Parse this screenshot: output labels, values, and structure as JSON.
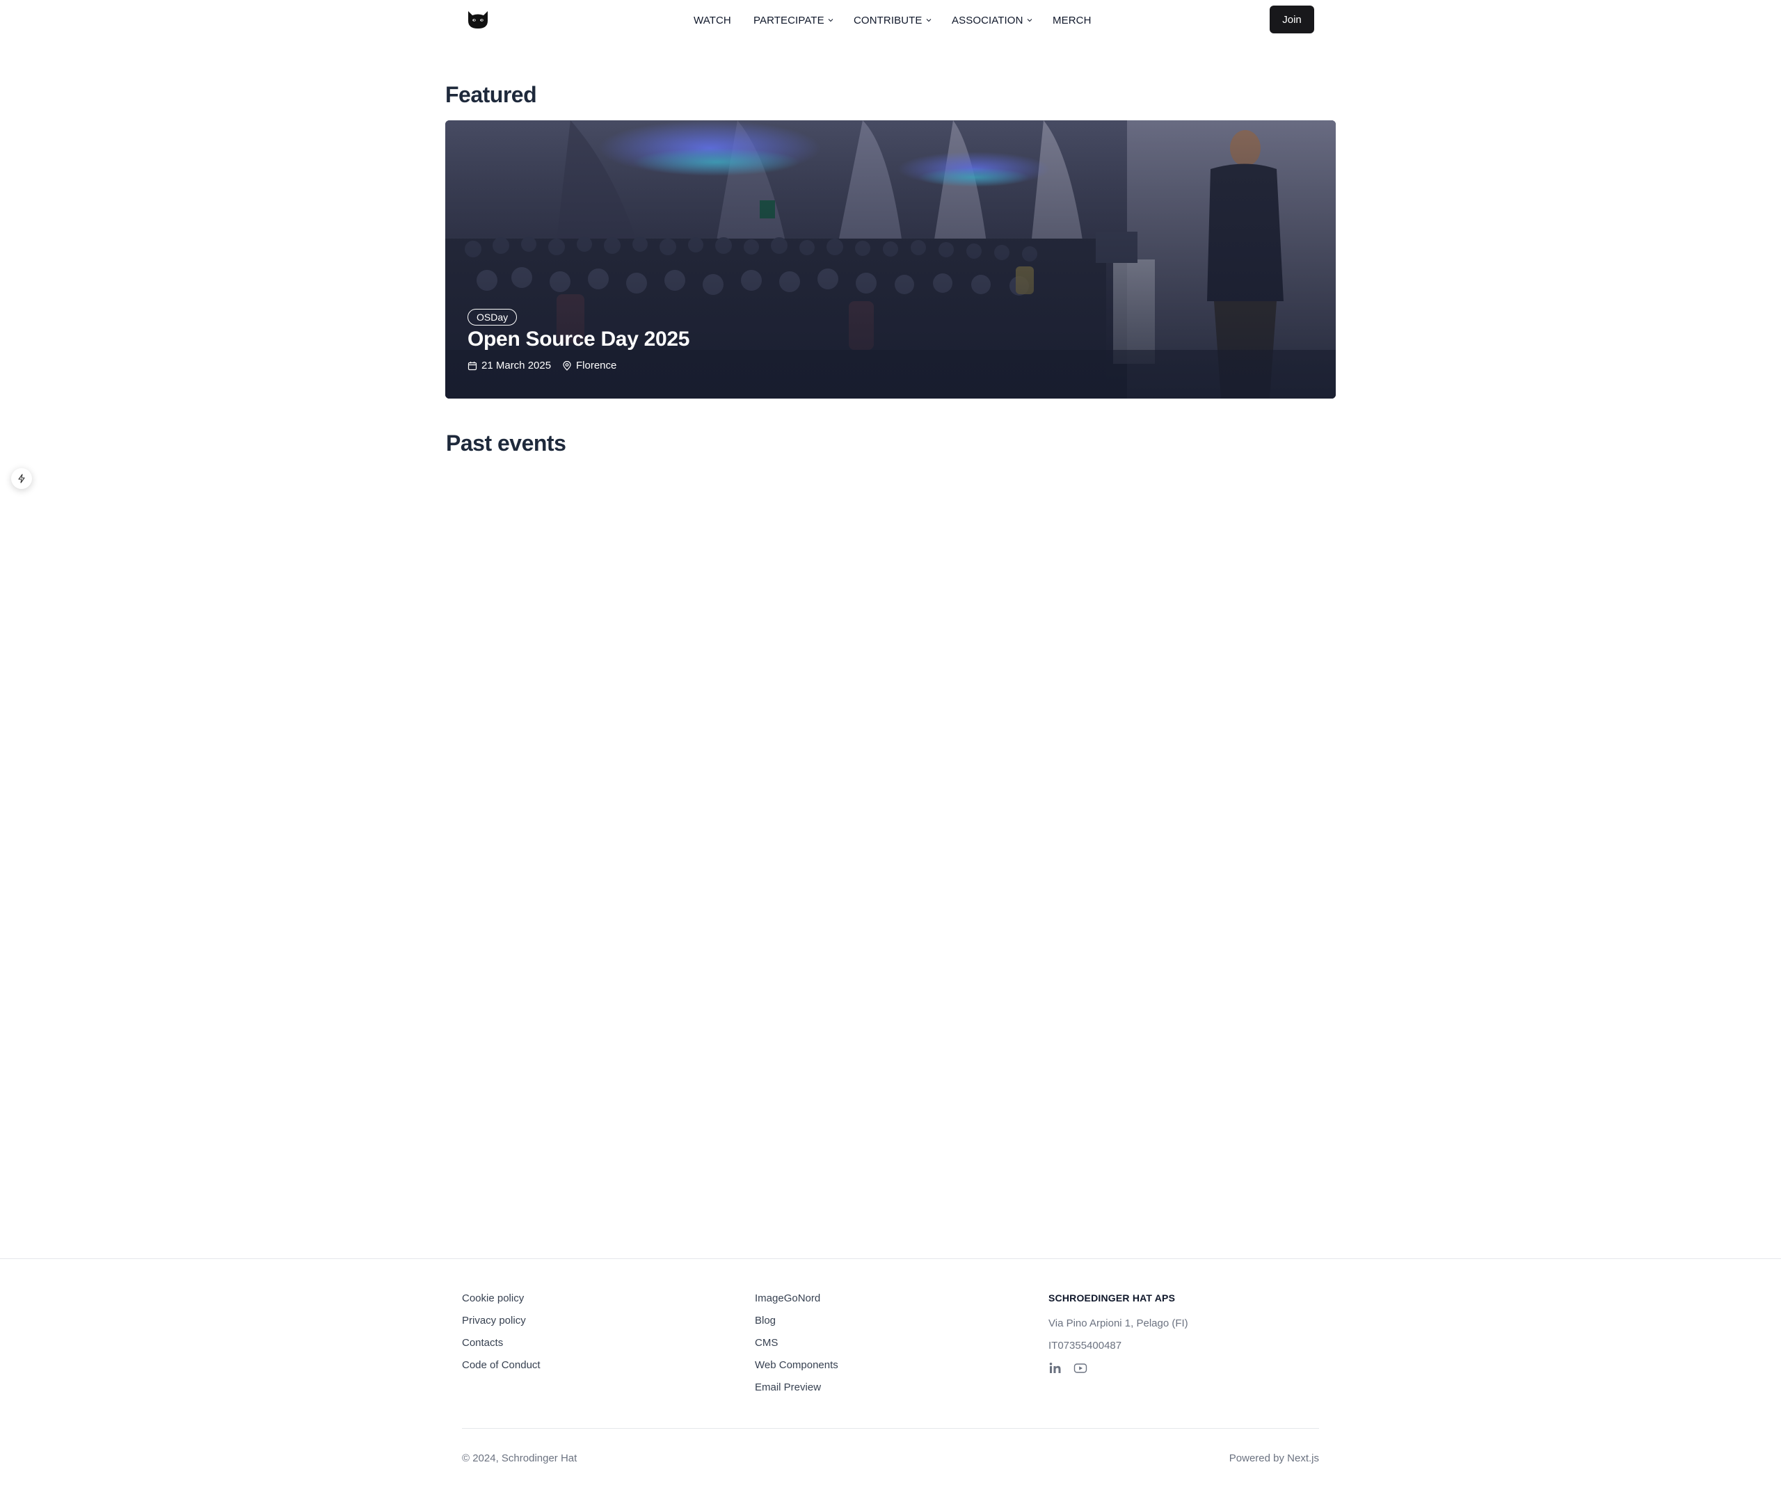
{
  "header": {
    "logo_icon": "cat-face-icon",
    "nav": [
      {
        "label": "WATCH",
        "has_dropdown": false
      },
      {
        "label": "PARTECIPATE",
        "has_dropdown": true
      },
      {
        "label": "CONTRIBUTE",
        "has_dropdown": true
      },
      {
        "label": "ASSOCIATION",
        "has_dropdown": true
      },
      {
        "label": "MERCH",
        "has_dropdown": false
      }
    ],
    "join_label": "Join"
  },
  "featured": {
    "heading": "Featured",
    "card": {
      "tag": "OSDay",
      "title": "Open Source Day 2025",
      "date": "21 March 2025",
      "location": "Florence"
    }
  },
  "past_events": {
    "heading": "Past events"
  },
  "footer": {
    "col1": [
      "Cookie policy",
      "Privacy policy",
      "Contacts",
      "Code of Conduct"
    ],
    "col2": [
      "ImageGoNord",
      "Blog",
      "CMS",
      "Web Components",
      "Email Preview"
    ],
    "company": {
      "name": "SCHROEDINGER HAT APS",
      "address": "Via Pino Arpioni 1, Pelago (FI)",
      "vat": "IT07355400487",
      "social_icons": [
        "linkedin-icon",
        "youtube-icon"
      ]
    },
    "copyright": "© 2024, Schrodinger Hat",
    "powered_by": "Powered by Next.js"
  },
  "colors": {
    "text": "#0f172a",
    "heading": "#1e293b",
    "button_bg": "#18181b",
    "muted": "#6b7280"
  }
}
